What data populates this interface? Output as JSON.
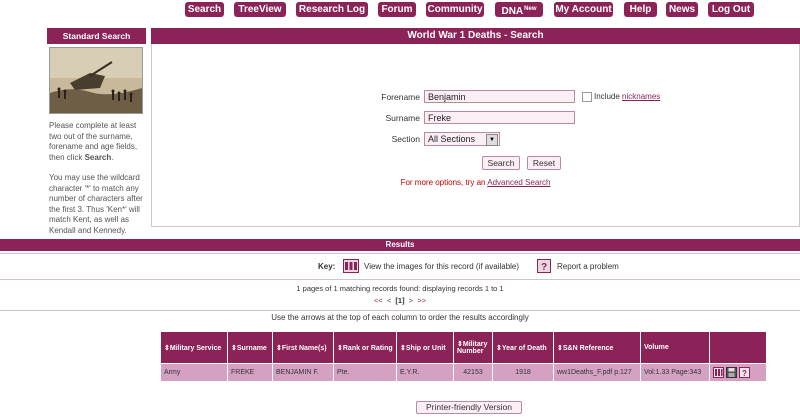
{
  "nav": {
    "search": "Search",
    "treeview": "TreeView",
    "research_log": "Research Log",
    "forum": "Forum",
    "community": "Community",
    "dna": "DNA",
    "dna_badge": "New",
    "my_account": "My Account",
    "help": "Help",
    "news": "News",
    "logout": "Log Out"
  },
  "sidebar": {
    "title": "Standard Search",
    "text1_a": "Please complete at least two out of the surname, forename and age fields, then click ",
    "text1_b": "Search",
    "text1_c": ".",
    "text2": "You may use the wildcard character '*' to match any number of characters after the first 3. Thus 'Ken*' will match Kent, as well as Kendall and Kennedy."
  },
  "main": {
    "title": "World War 1 Deaths - Search",
    "forename_label": "Forename",
    "forename_value": "Benjamin",
    "include_label": "Include ",
    "nicknames_link": "nicknames",
    "surname_label": "Surname",
    "surname_value": "Freke",
    "section_label": "Section",
    "section_value": "All Sections",
    "search_button": "Search",
    "reset_button": "Reset",
    "more_options": "For more options, try an ",
    "advanced_link": "Advanced Search"
  },
  "results": {
    "header": "Results",
    "key_label": "Key:",
    "key_view": "View the images for this record (if available)",
    "key_report": "Report a problem",
    "summary": "1 pages of 1 matching records found: displaying records 1 to 1",
    "pager_first": "<<",
    "pager_prev": "<",
    "pager_current": "[1]",
    "pager_next": ">",
    "pager_last": ">>",
    "order_hint": "Use the arrows at the top of each column to order the results accordingly",
    "columns": [
      "Military Service",
      "Surname",
      "First Name(s)",
      "Rank or Rating",
      "Ship or Unit",
      "Military Number",
      "Year of Death",
      "S&N Reference",
      "Volume"
    ],
    "row": [
      "Army",
      "FREKE",
      "BENJAMIN F.",
      "Pte.",
      "E.Y.R.",
      "42153",
      "1918",
      "ww1Deaths_F.pdf p.127",
      "Vol:1.33 Page:343"
    ],
    "printer_button": "Printer-friendly Version"
  },
  "colors": {
    "brand": "#8c2358",
    "row_bg": "#d4a1c3",
    "input_bg": "#fbeef4",
    "advanced_hint": "#c00000"
  },
  "icons": [
    "view-images-icon",
    "report-problem-icon",
    "save-icon",
    "sort-arrows-icon"
  ]
}
